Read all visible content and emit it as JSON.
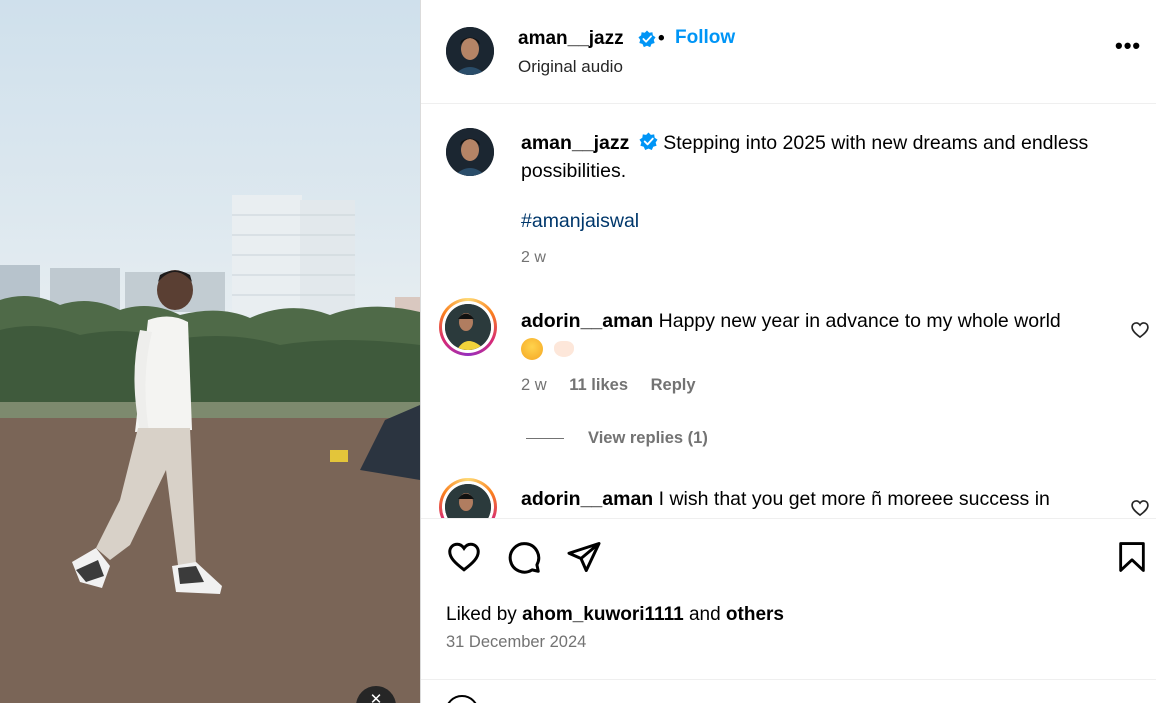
{
  "colors": {
    "accent": "#0095f6",
    "hashtag": "#00376b",
    "muted": "#737373",
    "divider": "#dbdbdb"
  },
  "post": {
    "author": "aman__jazz",
    "follow_label": "Follow",
    "separator": "•",
    "audio": "Original audio",
    "more_icon": "more-horizontal-icon"
  },
  "caption": {
    "author": "aman__jazz",
    "text": "Stepping into 2025 with new dreams and endless possibilities.",
    "hashtag": "#amanjaiswal",
    "time": "2 w"
  },
  "comments": [
    {
      "author": "adorin__aman",
      "text": "Happy new year in advance to my whole world",
      "emojis": [
        "smiling-face",
        "heart-hands"
      ],
      "time": "2 w",
      "likes": "11 likes",
      "reply_label": "Reply",
      "view_replies": "View replies (1)"
    },
    {
      "author": "adorin__aman",
      "text": "I wish that you get more ñ moreee success in"
    }
  ],
  "actions": {
    "liked_prefix": "Liked by",
    "liked_user": "ahom_kuwori1111",
    "liked_and": "and",
    "liked_others": "others",
    "date": "31 December 2024"
  }
}
